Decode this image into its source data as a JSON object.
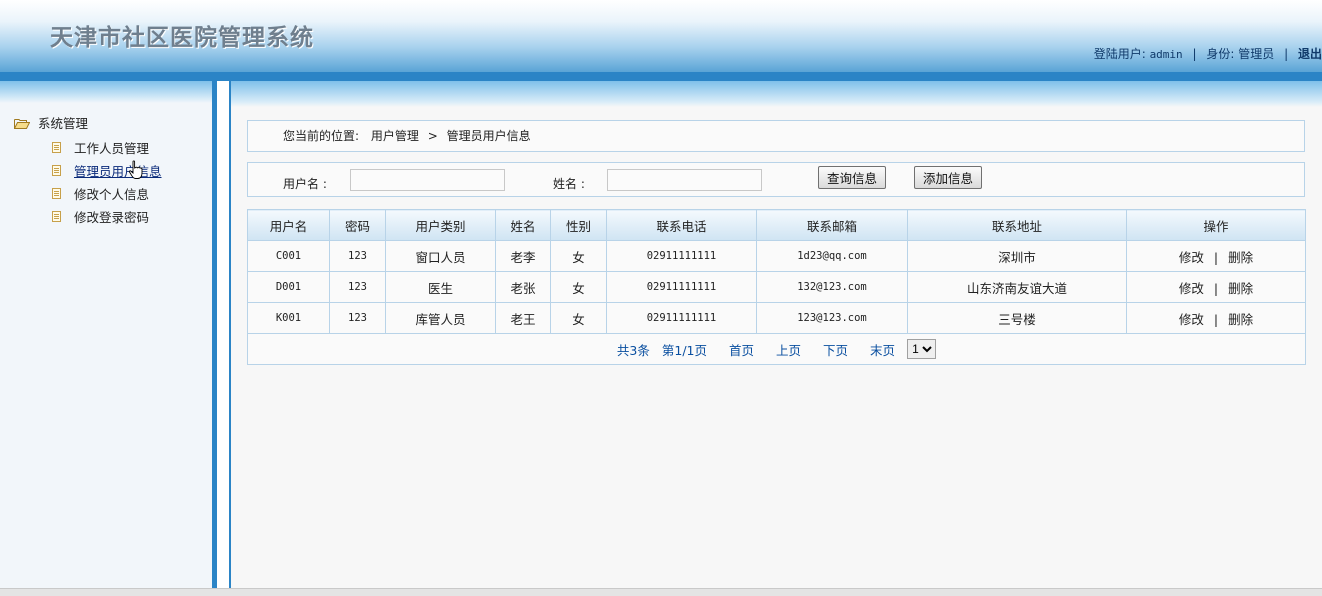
{
  "header": {
    "title": "天津市社区医院管理系统",
    "user_label": "登陆用户:",
    "username": "admin",
    "role_label": "身份:",
    "role": "管理员",
    "logout": "退出"
  },
  "sidebar": {
    "root": "系统管理",
    "items": [
      {
        "label": "工作人员管理"
      },
      {
        "label": "管理员用户信息",
        "active": true
      },
      {
        "label": "修改个人信息"
      },
      {
        "label": "修改登录密码"
      }
    ]
  },
  "breadcrumb": {
    "prefix": "您当前的位置:",
    "level1": "用户管理",
    "separator": ">",
    "level2": "管理员用户信息"
  },
  "search": {
    "username_label": "用户名  :",
    "username_value": "",
    "name_label": "姓名  :",
    "name_value": "",
    "query_button": "查询信息",
    "add_button": "添加信息"
  },
  "table": {
    "headers": [
      "用户名",
      "密码",
      "用户类别",
      "姓名",
      "性别",
      "联系电话",
      "联系邮箱",
      "联系地址",
      "操作"
    ],
    "rows": [
      {
        "username": "C001",
        "password": "123",
        "type": "窗口人员",
        "name": "老李",
        "gender": "女",
        "phone": "02911111111",
        "email": "1d23@qq.com",
        "address": "深圳市"
      },
      {
        "username": "D001",
        "password": "123",
        "type": "医生",
        "name": "老张",
        "gender": "女",
        "phone": "02911111111",
        "email": "132@123.com",
        "address": "山东济南友谊大道"
      },
      {
        "username": "K001",
        "password": "123",
        "type": "库管人员",
        "name": "老王",
        "gender": "女",
        "phone": "02911111111",
        "email": "123@123.com",
        "address": "三号楼"
      }
    ],
    "edit_label": "修改",
    "op_separator": "|",
    "delete_label": "删除"
  },
  "pager": {
    "total": "共3条",
    "page": "第1/1页",
    "first": "首页",
    "prev": "上页",
    "next": "下页",
    "last": "末页",
    "selected": "1",
    "options": [
      "1"
    ]
  }
}
